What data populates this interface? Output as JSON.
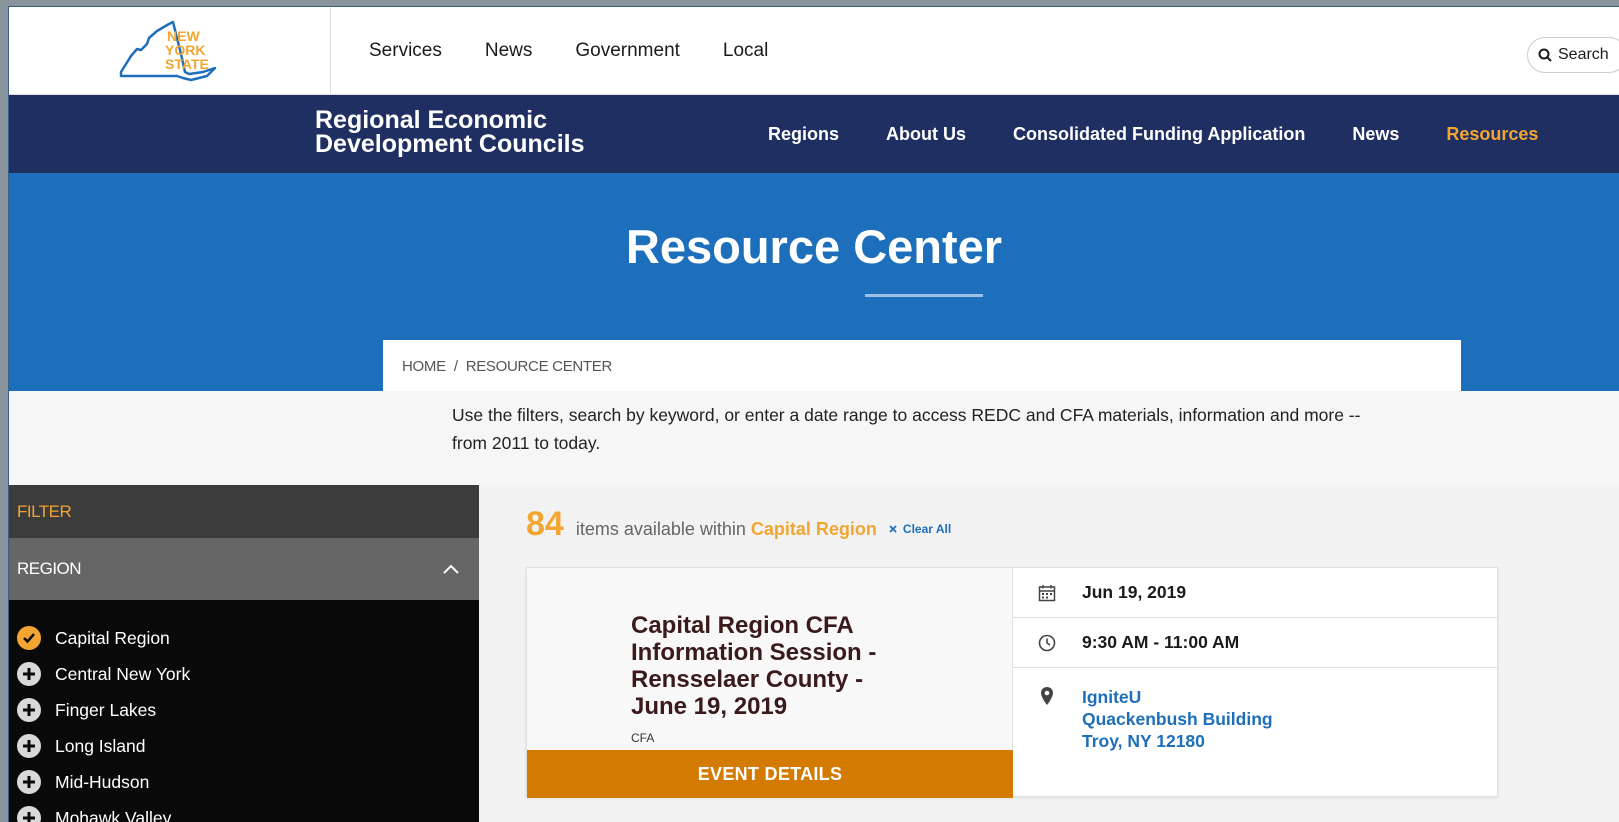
{
  "top_nav": {
    "logo_text": "NEW YORK STATE",
    "items": [
      "Services",
      "News",
      "Government",
      "Local"
    ],
    "search_label": "Search"
  },
  "redc_nav": {
    "title_line1": "Regional Economic",
    "title_line2": "Development Councils",
    "items": [
      "Regions",
      "About Us",
      "Consolidated Funding Application",
      "News",
      "Resources"
    ],
    "active_item": "Resources",
    "accent_color": "#f2a631"
  },
  "hero": {
    "title": "Resource Center"
  },
  "breadcrumb": {
    "home": "HOME",
    "separator": "/",
    "current": "RESOURCE CENTER"
  },
  "intro": {
    "text": "Use the filters, search by keyword, or enter a date range to access REDC and CFA materials, information and more -- from 2011 to today."
  },
  "sidebar": {
    "filter_label": "FILTER",
    "region_label": "REGION",
    "regions": [
      {
        "label": "Capital Region",
        "selected": true
      },
      {
        "label": "Central New York",
        "selected": false
      },
      {
        "label": "Finger Lakes",
        "selected": false
      },
      {
        "label": "Long Island",
        "selected": false
      },
      {
        "label": "Mid-Hudson",
        "selected": false
      },
      {
        "label": "Mohawk Valley",
        "selected": false
      }
    ]
  },
  "results": {
    "count": "84",
    "text": "items available within",
    "region": "Capital Region",
    "clear_label": "Clear All"
  },
  "event": {
    "title": "Capital Region CFA Information Session - Rensselaer County - June 19, 2019",
    "tag": "CFA",
    "button_label": "EVENT DETAILS",
    "date": "Jun 19, 2019",
    "time": "9:30 AM - 11:00 AM",
    "location_line1": "IgniteU",
    "location_line2": "Quackenbush Building",
    "location_line3": "Troy, NY 12180",
    "icons": [
      "calendar-icon",
      "clock-icon",
      "map-pin-icon"
    ]
  },
  "colors": {
    "navy": "#1f2f62",
    "blue": "#1e6fbb",
    "orange": "#f2a631",
    "button_orange": "#d37b00"
  }
}
